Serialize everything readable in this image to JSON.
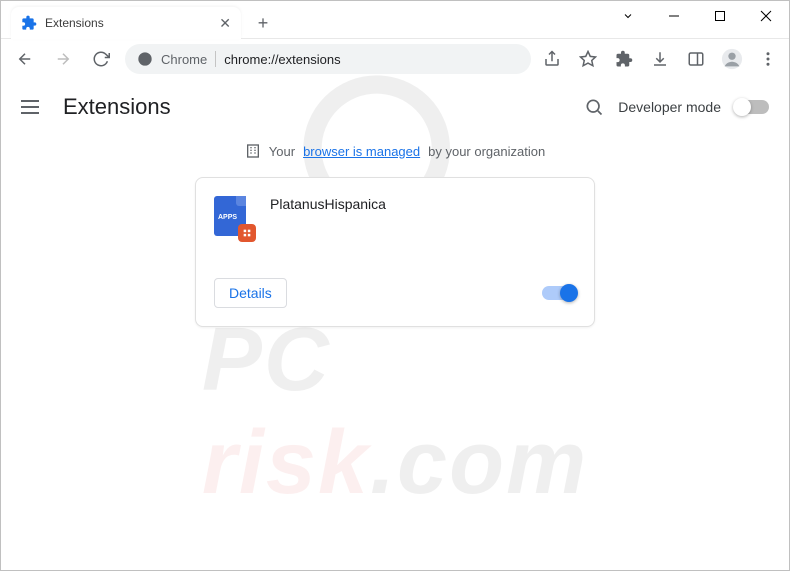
{
  "tab": {
    "title": "Extensions"
  },
  "omnibox": {
    "origin": "Chrome",
    "url": "chrome://extensions"
  },
  "header": {
    "title": "Extensions",
    "developer_mode": "Developer mode"
  },
  "managed": {
    "prefix": "Your",
    "link": "browser is managed",
    "suffix": "by your organization"
  },
  "extension": {
    "name": "PlatanusHispanica",
    "icon_text": "APPS",
    "details_label": "Details",
    "enabled": true
  },
  "watermark": {
    "top": "PC",
    "bottom": "risk",
    "suffix": ".com"
  }
}
